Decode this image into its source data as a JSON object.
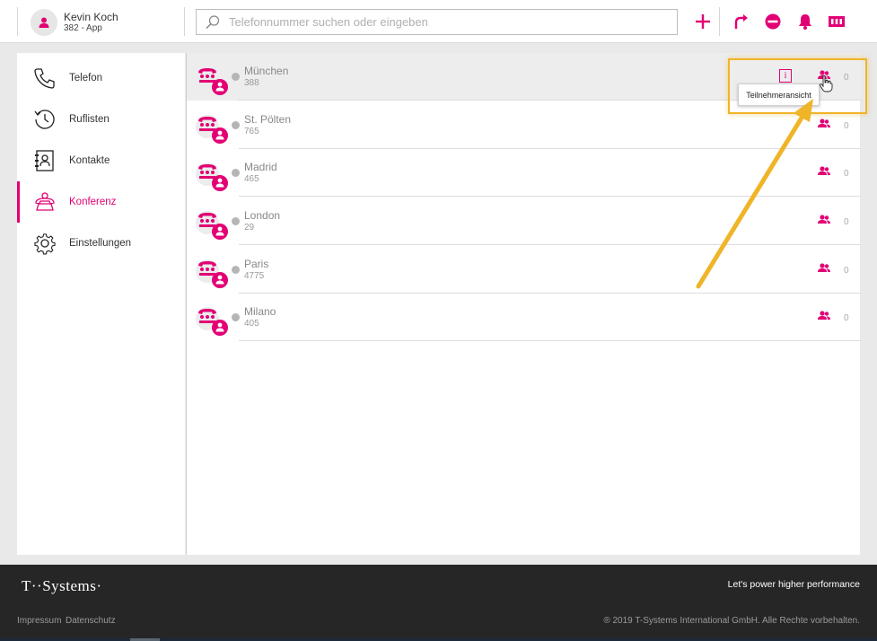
{
  "header": {
    "user_name": "Kevin Koch",
    "user_sub": "382 - App",
    "search_placeholder": "Telefonnummer suchen oder eingeben"
  },
  "sidebar": {
    "items": [
      {
        "label": "Telefon",
        "icon": "phone-icon"
      },
      {
        "label": "Ruflisten",
        "icon": "clock-history-icon"
      },
      {
        "label": "Kontakte",
        "icon": "contact-book-icon"
      },
      {
        "label": "Konferenz",
        "icon": "conference-icon",
        "active": true
      },
      {
        "label": "Einstellungen",
        "icon": "gear-icon"
      }
    ]
  },
  "conferences": [
    {
      "name": "München",
      "number": "388",
      "count": "0"
    },
    {
      "name": "St. Pölten",
      "number": "765",
      "count": "0"
    },
    {
      "name": "Madrid",
      "number": "465",
      "count": "0"
    },
    {
      "name": "London",
      "number": "29",
      "count": "0"
    },
    {
      "name": "Paris",
      "number": "4775",
      "count": "0"
    },
    {
      "name": "Milano",
      "number": "405",
      "count": "0"
    }
  ],
  "tooltip": "Teilnehmeransicht",
  "footer": {
    "logo": "T··Systems·",
    "tagline": "Let's power higher performance",
    "links": [
      "Impressum",
      "Datenschutz"
    ],
    "copyright": "® 2019 T-Systems International GmbH. Alle Rechte vorbehalten."
  },
  "colors": {
    "accent": "#e20074",
    "highlight": "#f0b428"
  }
}
